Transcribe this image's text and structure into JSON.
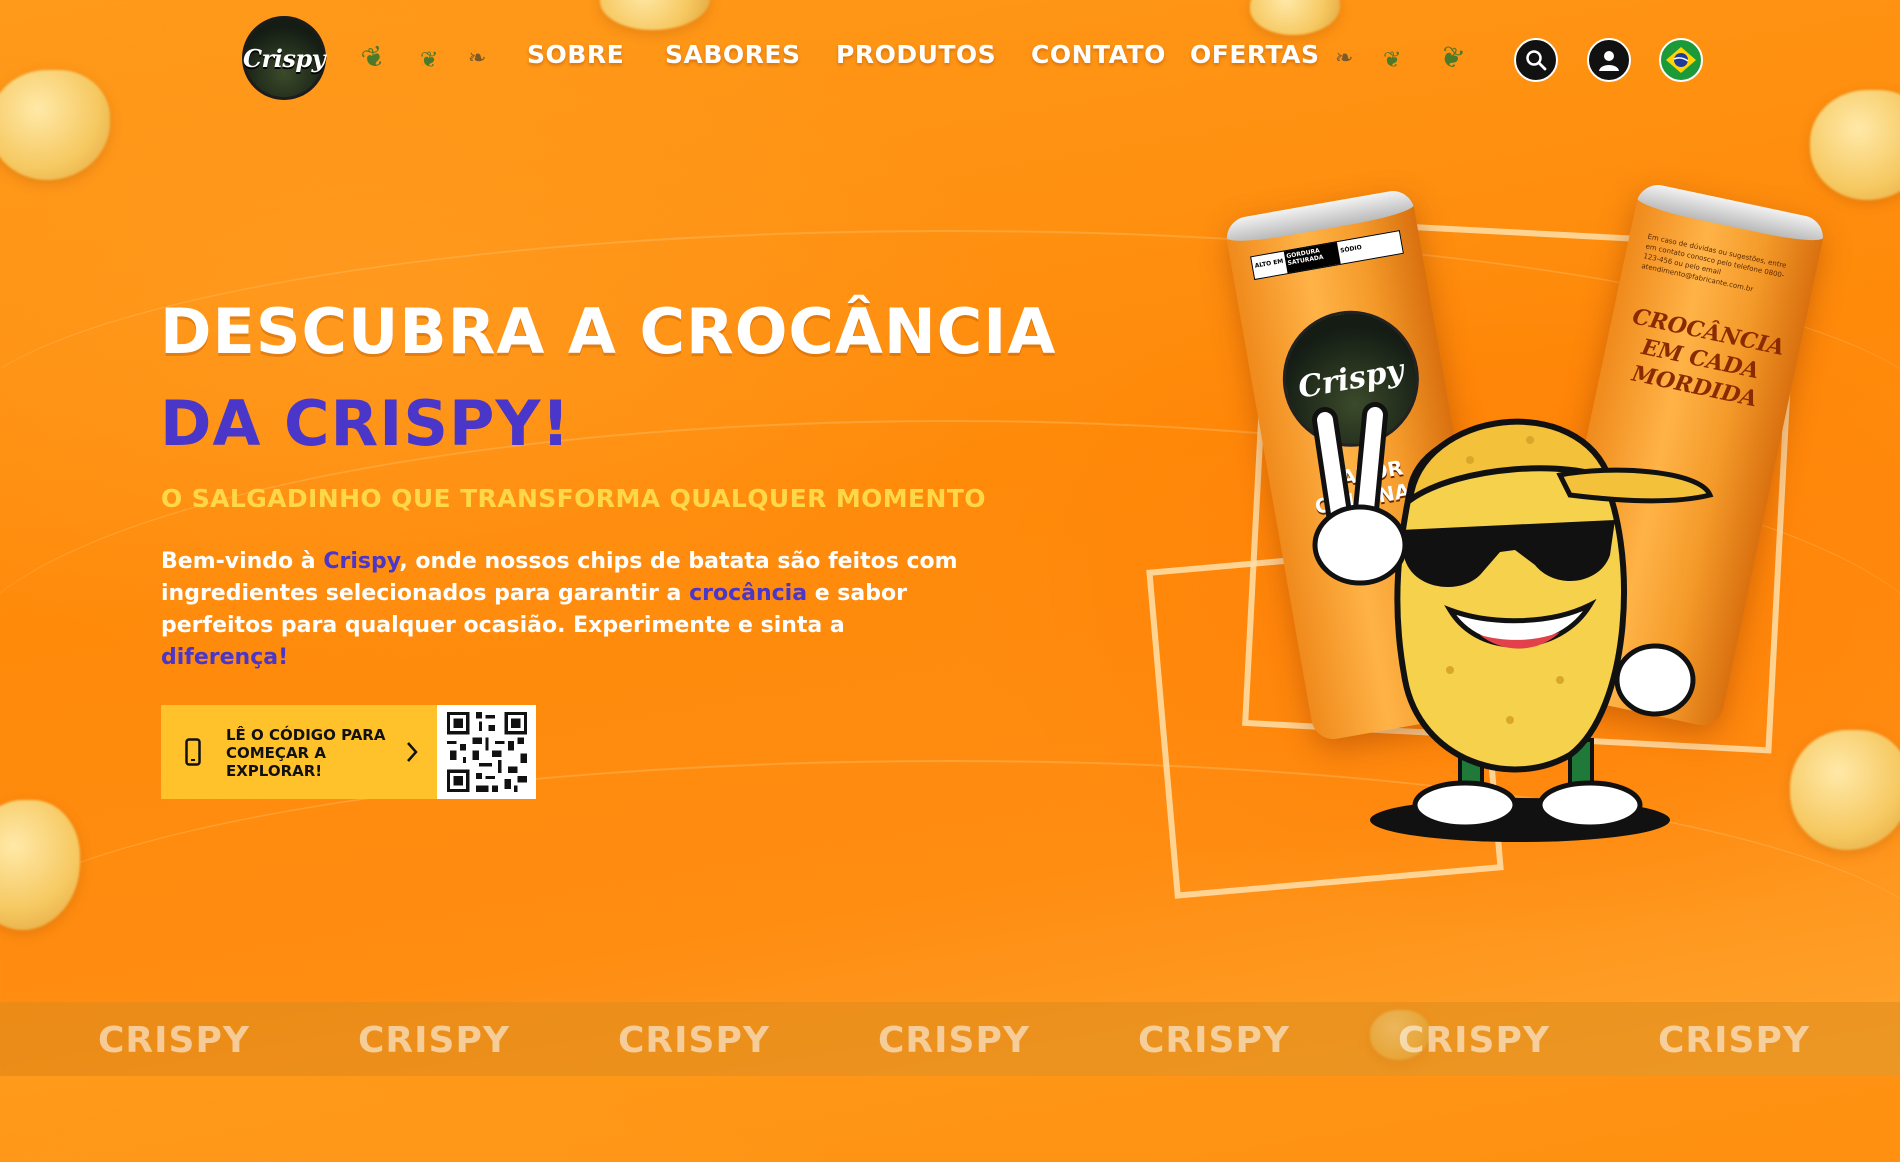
{
  "brand": {
    "logo_text": "Crispy"
  },
  "nav": {
    "items": [
      {
        "label": "SOBRE"
      },
      {
        "label": "SABORES"
      },
      {
        "label": "PRODUTOS"
      },
      {
        "label": "CONTATO"
      },
      {
        "label": "OFERTAS"
      }
    ],
    "icons": [
      "search-icon",
      "user-icon",
      "brazil-flag-icon"
    ]
  },
  "hero": {
    "title_line1": "DESCUBRA A CROCÂNCIA",
    "title_line2": "DA CRISPY!",
    "subtitle": "O SALGADINHO QUE TRANSFORMA QUALQUER MOMENTO",
    "paragraph": {
      "p1": "Bem-vindo à ",
      "h1": "Crispy",
      "p2": ", onde nossos chips de batata são feitos com ingredientes selecionados para garantir a ",
      "h2": "crocância",
      "p3": " e sabor perfeitos para qualquer ocasião. Experimente e sinta a ",
      "h3": "diferença!"
    },
    "cta_text": "LÊ O CÓDIGO PARA COMEÇAR A EXPLORAR!"
  },
  "product": {
    "can_front_logo": "Crispy",
    "can_front_flavor": "SABOR ORIGINAL",
    "can_front_warning_1": "ALTO EM",
    "can_front_warning_2": "GORDURA SATURADA",
    "can_front_warning_3": "SÓDIO",
    "can_back_slogan": "CROCÂNCIA EM CADA MORDIDA",
    "can_back_info": "Em caso de dúvidas ou sugestões, entre em contato conosco pelo telefone 0800-123-456 ou pelo email atendimento@fabricante.com.br"
  },
  "footer_band": {
    "word": "CRISPY",
    "repeat": [
      "CRISPY",
      "CRISPY",
      "CRISPY",
      "CRISPY",
      "CRISPY",
      "CRISPY",
      "CRISPY"
    ]
  },
  "colors": {
    "accent_purple": "#4a36c9",
    "accent_yellow": "#ffd84a",
    "bg_orange": "#ff8a0a"
  }
}
